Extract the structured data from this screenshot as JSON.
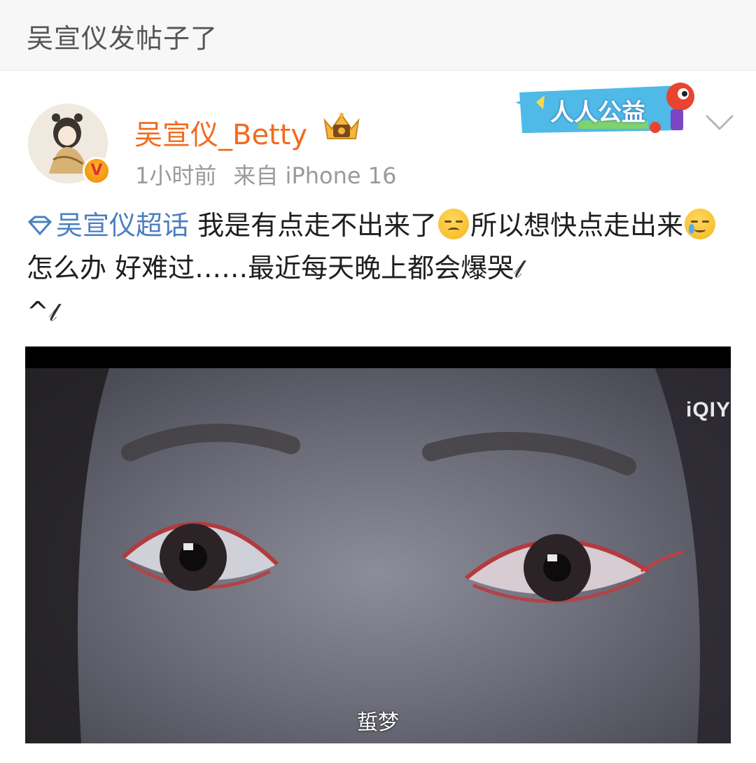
{
  "header": {
    "title": "吴宣仪发帖子了"
  },
  "post": {
    "username": "吴宣仪_Betty",
    "time": "1小时前",
    "source": "来自 iPhone 16",
    "topic": "吴宣仪超话",
    "text_part1": " 我是有点走不出来了",
    "text_part2": "所以想快点走出来",
    "text_part3": "怎么办 好难过……最近每天晚上都会爆哭",
    "text_part4": "^",
    "emojis": [
      "pensive-emoji",
      "crying-smile-emoji"
    ],
    "verified_badge": "V"
  },
  "banner": {
    "text": "人人公益"
  },
  "media": {
    "watermark": "iQIY",
    "subtitle": "蜇梦"
  },
  "colors": {
    "username": "#f26b1d",
    "topic": "#4a7fc1",
    "meta": "#9a9a9a"
  }
}
